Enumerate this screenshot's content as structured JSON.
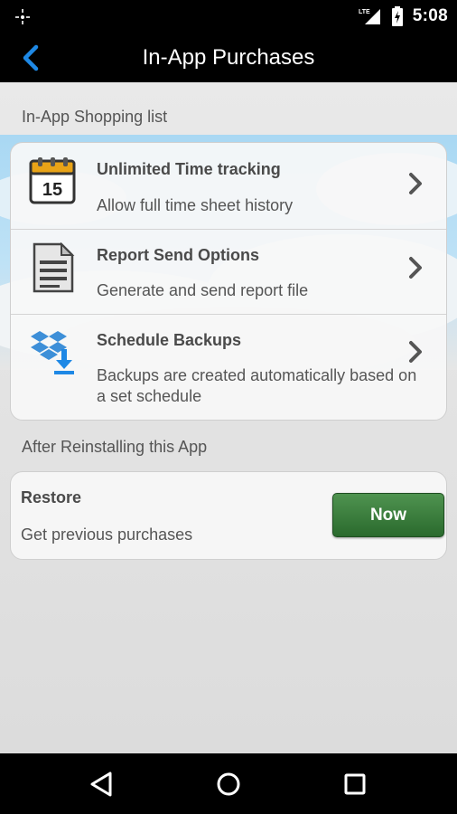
{
  "status_bar": {
    "time": "5:08",
    "network": "LTE"
  },
  "action_bar": {
    "title": "In-App Purchases",
    "back_icon": "chevron-left-icon",
    "accent": "#1e88e5"
  },
  "shopping": {
    "header": "In-App Shopping list",
    "items": [
      {
        "title": "Unlimited Time tracking",
        "subtitle": "Allow full time sheet history",
        "icon": "calendar-icon",
        "calendar_day": "15"
      },
      {
        "title": "Report Send Options",
        "subtitle": "Generate and send report file",
        "icon": "document-icon"
      },
      {
        "title": "Schedule Backups",
        "subtitle": "Backups are created automatically based on a set schedule",
        "icon": "dropbox-download-icon"
      }
    ]
  },
  "reinstall": {
    "header": "After Reinstalling this App",
    "title": "Restore",
    "subtitle": "Get previous purchases",
    "button_label": "Now",
    "button_color": "#3a7d3c"
  },
  "nav_bar": {
    "back": "nav-back-icon",
    "home": "nav-home-icon",
    "recents": "nav-recents-icon"
  }
}
